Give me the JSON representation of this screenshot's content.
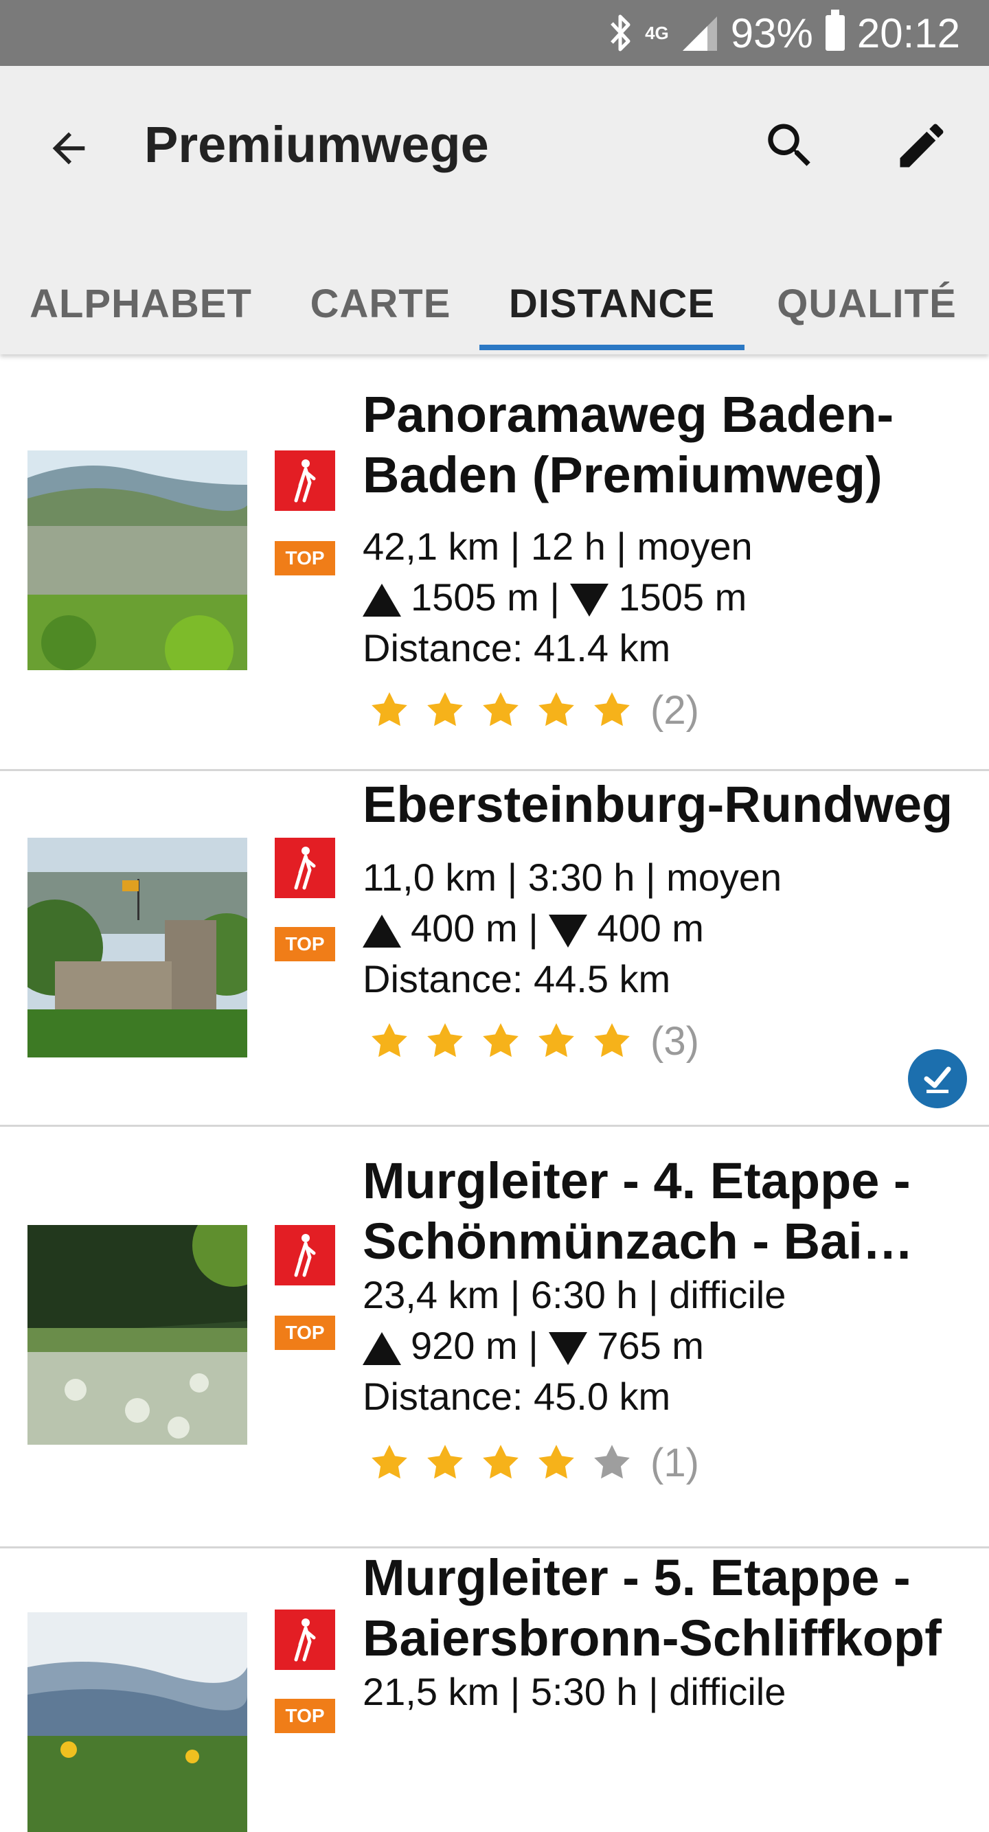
{
  "status_bar": {
    "network": "4G",
    "battery": "93%",
    "time": "20:12"
  },
  "app_bar": {
    "title": "Premiumwege"
  },
  "tabs": [
    {
      "label": "ALPHABET",
      "active": false
    },
    {
      "label": "CARTE",
      "active": false
    },
    {
      "label": "DISTANCE",
      "active": true
    },
    {
      "label": "QUALITÉ",
      "active": false
    }
  ],
  "badges": {
    "top": "TOP"
  },
  "routes": [
    {
      "name": "Panoramaweg Baden-Baden (Premiumweg)",
      "info": "42,1 km | 12 h | moyen",
      "ascent": "1505 m",
      "descent": "1505 m",
      "distance": "Distance: 41.4 km",
      "rating": 5,
      "reviews": "(2)",
      "completed": false
    },
    {
      "name": "Ebersteinburg-Rundweg",
      "info": "11,0 km | 3:30 h | moyen",
      "ascent": "400 m",
      "descent": "400 m",
      "distance": "Distance: 44.5 km",
      "rating": 5,
      "reviews": "(3)",
      "completed": true
    },
    {
      "name": "Murgleiter - 4. Etappe - Schönmünzach - Bai…",
      "info": "23,4 km | 6:30 h | difficile",
      "ascent": "920 m",
      "descent": "765 m",
      "distance": "Distance: 45.0 km",
      "rating": 4,
      "reviews": "(1)",
      "completed": false
    },
    {
      "name": "Murgleiter - 5. Etappe - Baiersbronn-Schliffkopf",
      "info": "21,5 km | 5:30 h | difficile",
      "completed": false
    }
  ],
  "colors": {
    "accent": "#2b78c4",
    "hike_badge": "#e31e24",
    "top_badge": "#f07d18",
    "star_on": "#f6b21a",
    "star_off": "#9e9e9e",
    "done": "#1c6fae"
  },
  "icons": [
    "bluetooth-icon",
    "signal-icon",
    "battery-icon",
    "back-arrow-icon",
    "search-icon",
    "edit-pencil-icon",
    "hiker-icon",
    "star-icon",
    "check-done-icon"
  ]
}
